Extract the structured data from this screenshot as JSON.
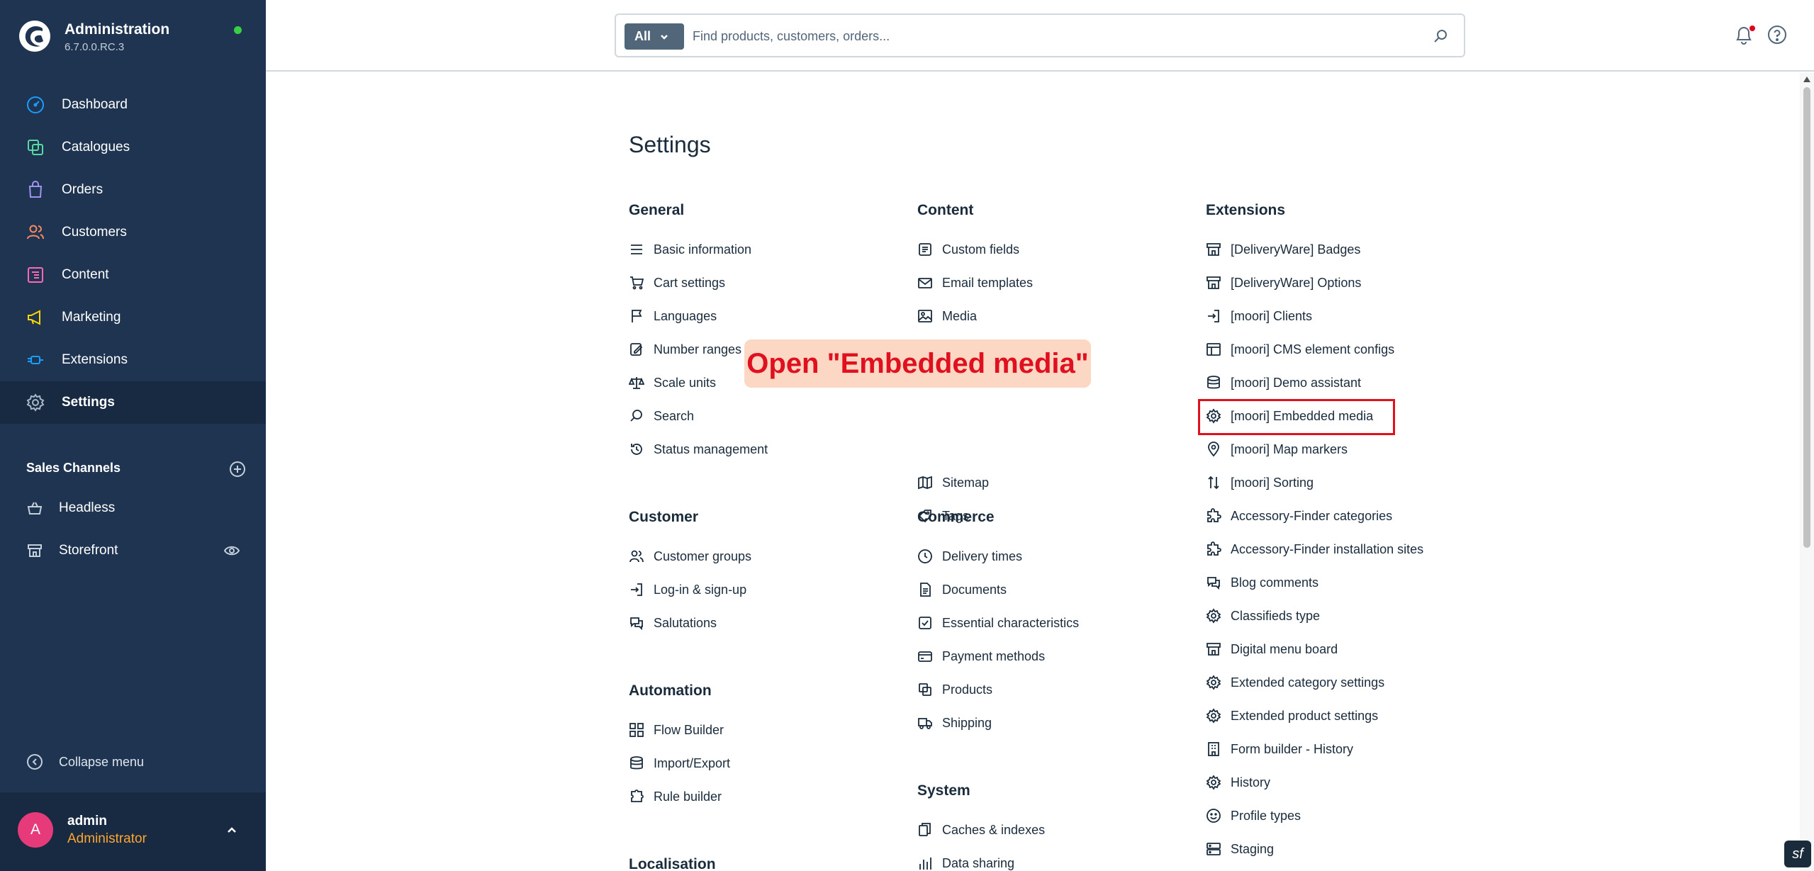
{
  "brand": {
    "title": "Administration",
    "version": "6.7.0.0.RC.3"
  },
  "nav": [
    {
      "label": "Dashboard",
      "icon": "dashboard-icon",
      "color": "#189eff"
    },
    {
      "label": "Catalogues",
      "icon": "catalogue-icon",
      "color": "#57d9a3"
    },
    {
      "label": "Orders",
      "icon": "orders-icon",
      "color": "#a092f0"
    },
    {
      "label": "Customers",
      "icon": "customers-icon",
      "color": "#f88962"
    },
    {
      "label": "Content",
      "icon": "content-icon",
      "color": "#ff68b4"
    },
    {
      "label": "Marketing",
      "icon": "marketing-icon",
      "color": "#ffd700"
    },
    {
      "label": "Extensions",
      "icon": "extensions-icon",
      "color": "#189eff"
    },
    {
      "label": "Settings",
      "icon": "settings-icon",
      "color": "#a8b8c8",
      "active": true
    }
  ],
  "sales_channels": {
    "title": "Sales Channels",
    "items": [
      {
        "label": "Headless",
        "icon": "basket-icon"
      },
      {
        "label": "Storefront",
        "icon": "storefront-icon"
      }
    ]
  },
  "collapse_label": "Collapse menu",
  "user": {
    "initial": "A",
    "name": "admin",
    "role": "Administrator"
  },
  "search": {
    "type": "All",
    "placeholder": "Find products, customers, orders..."
  },
  "page_title": "Settings",
  "groups": {
    "general": {
      "title": "General",
      "items": [
        "Basic information",
        "Cart settings",
        "Languages",
        "Number ranges",
        "Scale units",
        "Search",
        "Status management"
      ]
    },
    "customer": {
      "title": "Customer",
      "items": [
        "Customer groups",
        "Log-in & sign-up",
        "Salutations"
      ]
    },
    "automation": {
      "title": "Automation",
      "items": [
        "Flow Builder",
        "Import/Export",
        "Rule builder"
      ]
    },
    "localisation": {
      "title": "Localisation"
    },
    "content": {
      "title": "Content",
      "items": [
        "Custom fields",
        "Email templates",
        "Media",
        "",
        "",
        "Sitemap",
        "Tags"
      ]
    },
    "commerce": {
      "title": "Commerce",
      "items": [
        "Delivery times",
        "Documents",
        "Essential characteristics",
        "Payment methods",
        "Products",
        "Shipping"
      ]
    },
    "system": {
      "title": "System",
      "items": [
        "Caches & indexes",
        "Data sharing"
      ]
    },
    "extensions": {
      "title": "Extensions",
      "items": [
        "[DeliveryWare] Badges",
        "[DeliveryWare] Options",
        "[moori] Clients",
        "[moori] CMS element configs",
        "[moori] Demo assistant",
        "[moori] Embedded media",
        "[moori] Map markers",
        "[moori] Sorting",
        "Accessory-Finder categories",
        "Accessory-Finder installation sites",
        "Blog comments",
        "Classifieds type",
        "Digital menu board",
        "Extended category settings",
        "Extended product settings",
        "Form builder - History",
        "History",
        "Profile types",
        "Staging"
      ]
    }
  },
  "annotation": "Open \"Embedded media\"",
  "colors": {
    "sidebar": "#1e3450",
    "sidebar_active": "#172a42",
    "highlight": "#e0101f",
    "annotation_bg": "#fbd7c4",
    "avatar": "#e63a7a",
    "role": "#ffa630"
  }
}
